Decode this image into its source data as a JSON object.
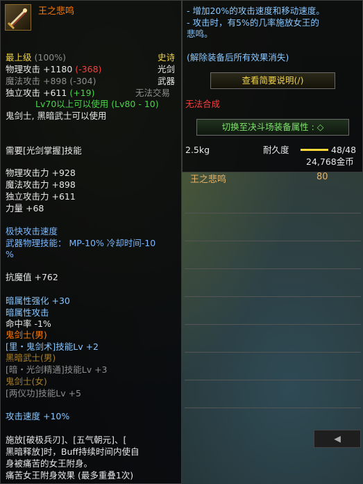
{
  "item": {
    "name": "王之悲鸣",
    "grade": "最上级",
    "grade_pct": "(100%)",
    "rarity": "史诗",
    "weapon_type": "光剑",
    "category": "武器",
    "trade": "无法交易",
    "phys_attack_label": "物理攻击",
    "phys_attack_value": "+1180",
    "phys_attack_diff": "(-368)",
    "mag_attack_label": "魔法攻击",
    "mag_attack_value": "+898",
    "mag_attack_diff": "(-304)",
    "indep_attack_label": "独立攻击",
    "indep_attack_value": "+611",
    "indep_attack_diff": "(+19)",
    "level_req": "Lv70以上可以使用 (Lv80 - 10)",
    "class_req": "鬼剑士, 黑暗武士可以使用",
    "skill_req": "需要[光剑掌握]技能",
    "stats": [
      {
        "label": "物理攻击力",
        "value": "+928"
      },
      {
        "label": "魔法攻击力",
        "value": "+898"
      },
      {
        "label": "独立攻击力",
        "value": "+611"
      },
      {
        "label": "力量",
        "value": "+68"
      }
    ],
    "speed_title": "极快攻击速度",
    "skill_line": "武器物理技能： MP-10% 冷却时间-10",
    "skill_line_wrap": "%",
    "magic_resist": "抗魔值 +762",
    "dark_boost": "暗属性强化 +30",
    "dark_attack": "暗属性攻击",
    "hit_rate": "命中率 -1%",
    "class_male": "鬼剑士(男)",
    "class_male_skill": "[里・鬼剑术]技能Lv +2",
    "class_dark": "黑暗武士(男)",
    "class_dark_skill": "[暗・光剑精通]技能Lv +3",
    "class_female": "鬼剑士(女)",
    "class_female_skill": "[两仪功]技能Lv +5",
    "attack_speed": "攻击速度 +10%",
    "desc": [
      "    施放[破极兵刃]、[五气朝元]、[",
      "黑暗释放]时，Buff持续时间内使自",
      "身被痛苦的女王附身。",
      "痛苦女王附身效果 (最多重叠1次)"
    ]
  },
  "right": {
    "effects": [
      "- 增加20%的攻击速度和移动速度。",
      "- 攻击时，有5%的几率施放女王的",
      "悲鸣。"
    ],
    "note": "(解除装备后所有效果消失)",
    "desc_button": "查看简要说明(/)",
    "no_synth": "无法合成",
    "switch_button": "切换至决斗场装备属性 : ◇",
    "weight": "2.5kg",
    "durability_label": "耐久度",
    "durability_value": "48/48",
    "durability_fraction": 1.0,
    "price": "24,768金币"
  },
  "background": {
    "list_name": "王之悲鸣",
    "list_value": "80"
  },
  "colors": {
    "epic": "#f1d348",
    "negative": "#ff3c3c",
    "positive": "#49d649",
    "panel_bg": "#060608"
  }
}
